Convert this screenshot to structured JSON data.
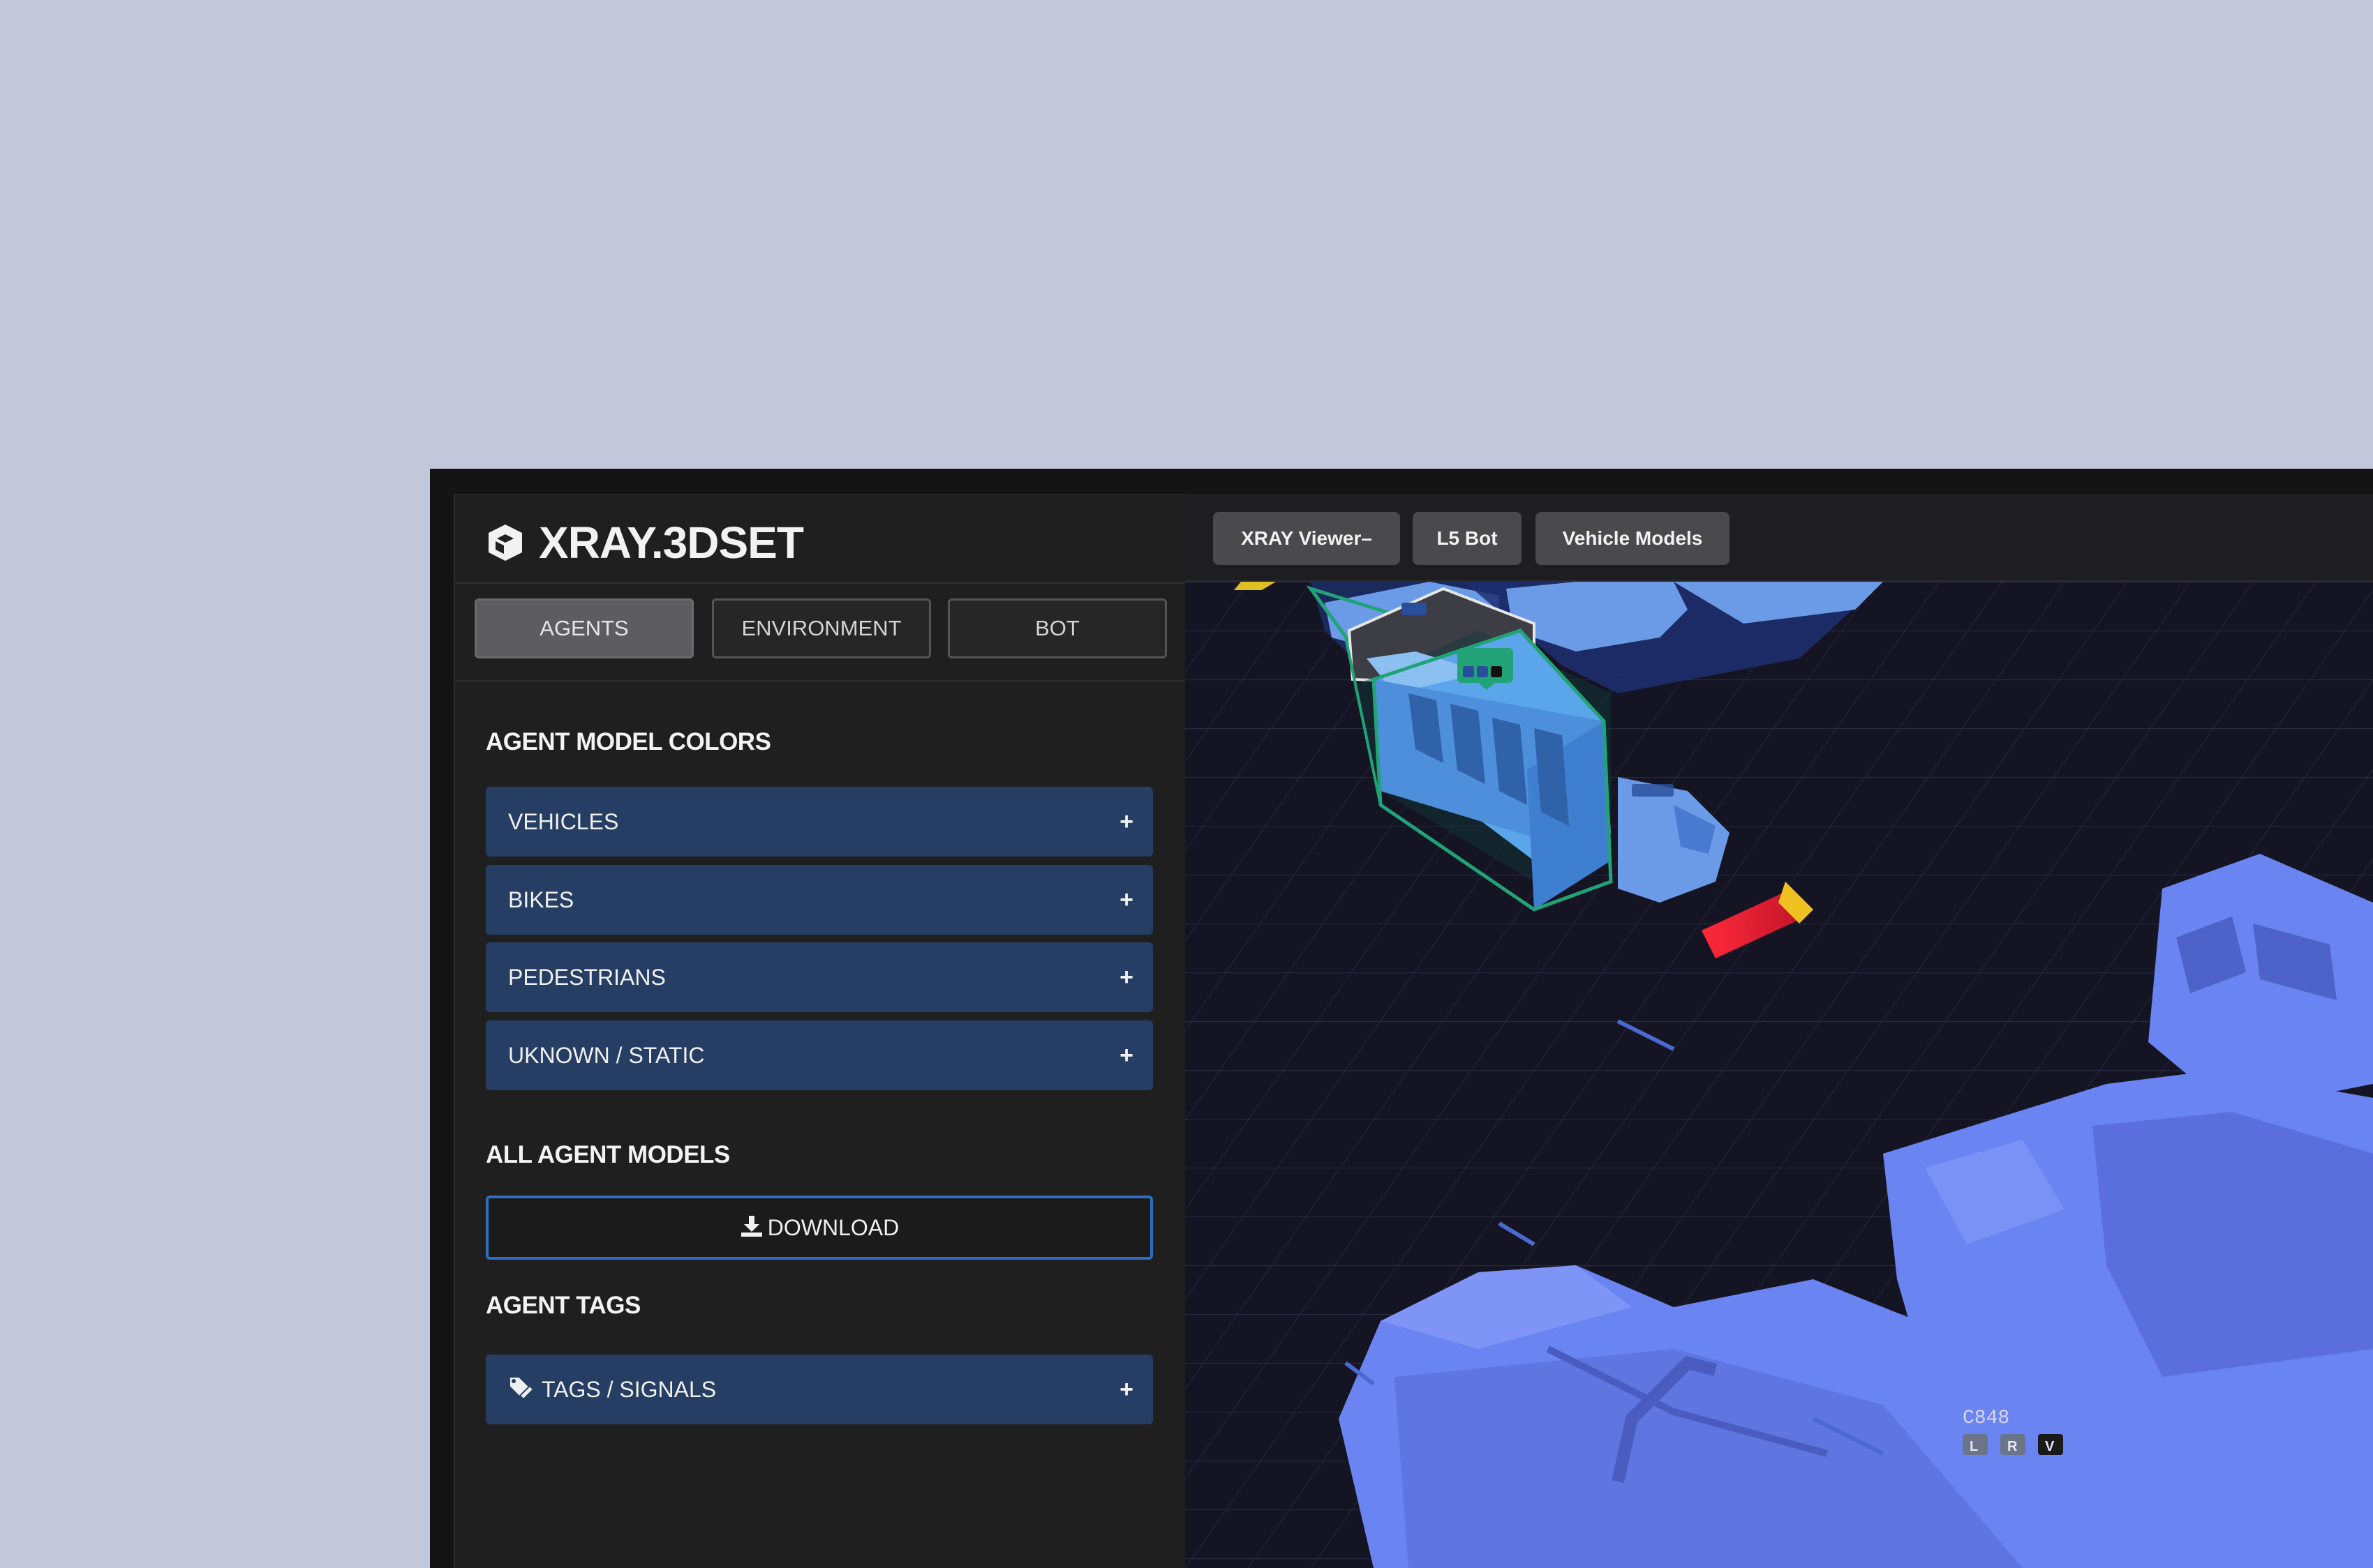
{
  "app": {
    "title": "XRAY.3DSET"
  },
  "side_tabs": [
    {
      "label": "AGENTS",
      "active": true
    },
    {
      "label": "ENVIRONMENT",
      "active": false
    },
    {
      "label": "BOT",
      "active": false
    }
  ],
  "agent_model_colors": {
    "heading": "AGENT MODEL COLORS",
    "items": [
      {
        "label": "VEHICLES",
        "toggle": "+"
      },
      {
        "label": "BIKES",
        "toggle": "+"
      },
      {
        "label": "PEDESTRIANS",
        "toggle": "+"
      },
      {
        "label": "UKNOWN / STATIC",
        "toggle": "+"
      }
    ]
  },
  "all_agent_models": {
    "heading": "ALL AGENT MODELS",
    "download_label": "DOWNLOAD",
    "download_icon": "download-icon"
  },
  "agent_tags": {
    "heading": "AGENT TAGS",
    "item": {
      "label": "TAGS / SIGNALS",
      "toggle": "+",
      "icon": "tags-icon"
    }
  },
  "toolbar": {
    "buttons": [
      {
        "label": "XRAY Viewer–"
      },
      {
        "label": "L5 Bot"
      },
      {
        "label": "Vehicle Models"
      }
    ]
  },
  "scene": {
    "agent_label": "C848",
    "agent_buttons": [
      "L",
      "R",
      "V"
    ]
  },
  "colors": {
    "page_bg": "#c3c8da",
    "panel_bg": "#1f1f20",
    "accordion_bg": "#263e63",
    "download_border": "#2f6dc0",
    "scene_bg": "#141423",
    "vehicle_blue": "#6a84f2",
    "bus_blue": "#5aa2e3",
    "selection_green": "#22a377"
  }
}
